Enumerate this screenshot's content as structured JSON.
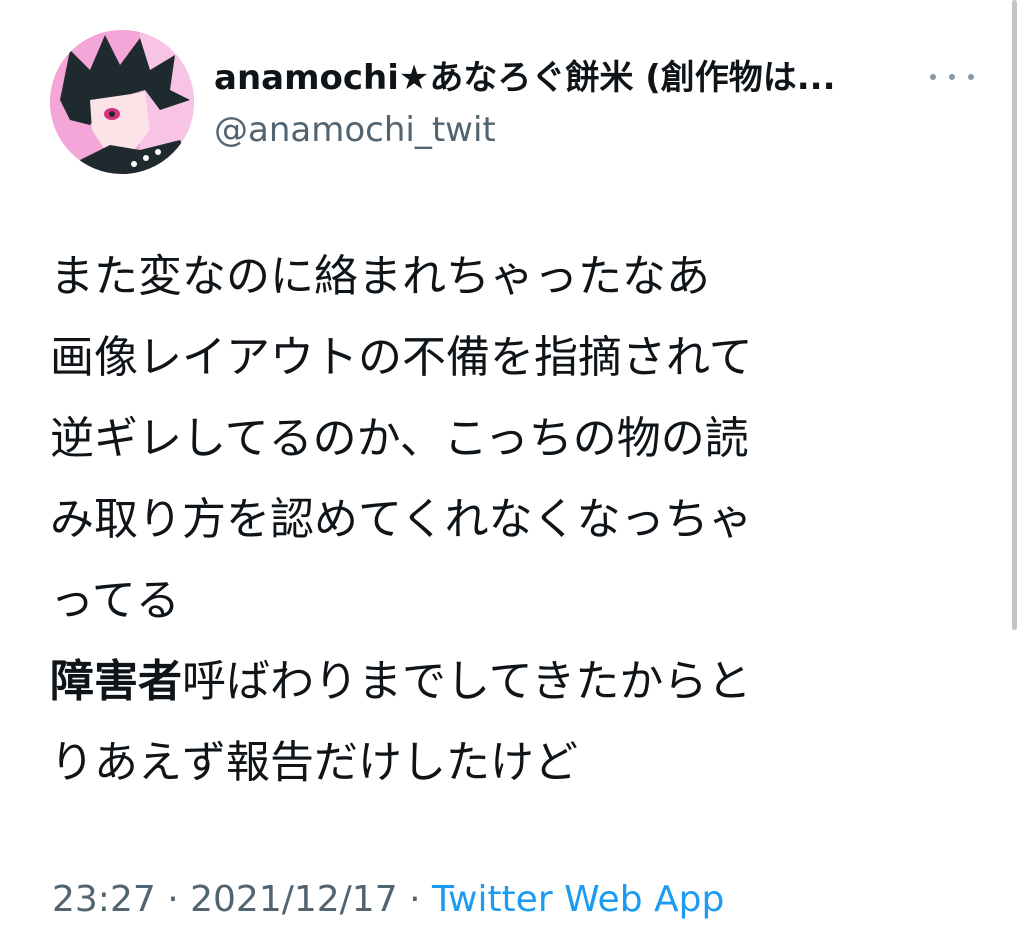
{
  "tweet": {
    "author_name": "anamochi★あなろぐ餅米 (創作物は...",
    "author_handle": "@anamochi_twit",
    "lines": [
      "また変なのに絡まれちゃったなあ",
      "画像レイアウトの不備を指摘されて",
      "逆ギレしてるのか、こっちの物の読",
      "み取り方を認めてくれなくなっちゃ",
      "ってる"
    ],
    "emphasis_line": {
      "bold": "障害者",
      "rest": "呼ばわりまでしてきたからと"
    },
    "last_line": "りあえず報告だけしたけど",
    "time": "23:27",
    "separator": "·",
    "date": "2021/12/17",
    "source": "Twitter Web App"
  },
  "icons": {
    "more": "more-options-icon",
    "avatar": "avatar-illustration"
  },
  "colors": {
    "text": "#0f1419",
    "secondary": "#536471",
    "link": "#1d9bf0",
    "avatar_bg": "#f3a6d7"
  }
}
